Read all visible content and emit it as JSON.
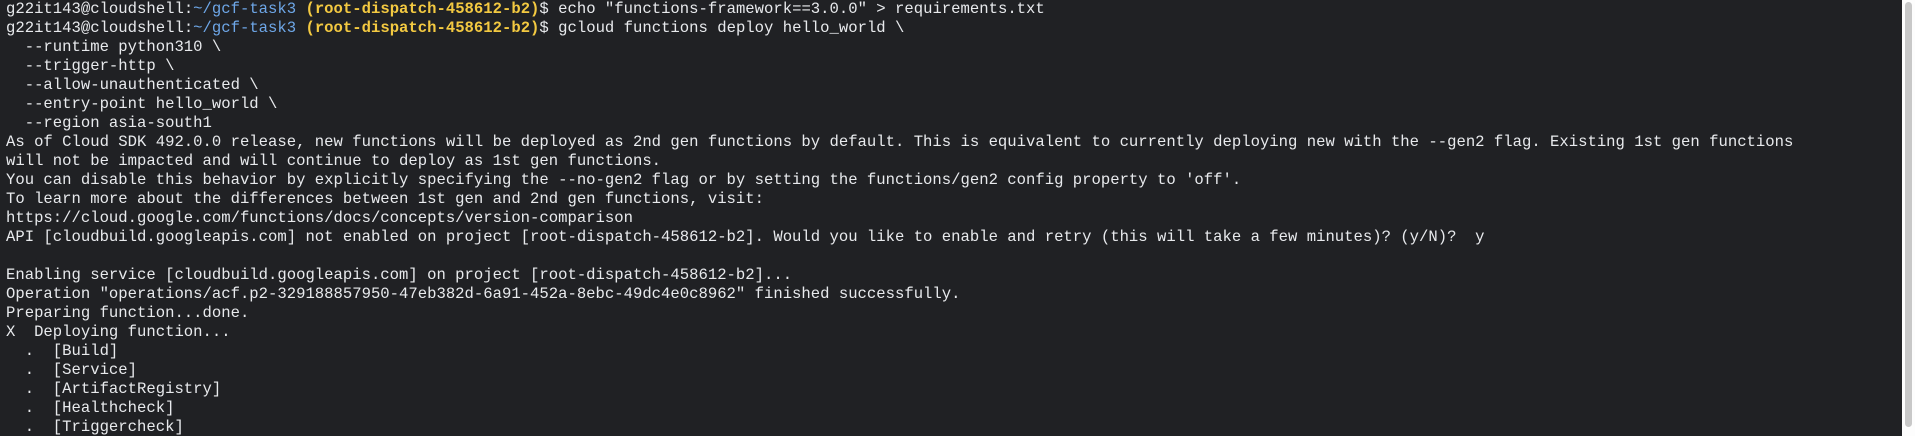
{
  "terminal": {
    "prompt": {
      "user_host": "g22it143@cloudshell",
      "separator": ":",
      "path": "~/gcf-task3",
      "project": "(root-dispatch-458612-b2)",
      "symbol": "$"
    },
    "commands": [
      "echo \"functions-framework==3.0.0\" > requirements.txt",
      "gcloud functions deploy hello_world \\"
    ],
    "output_lines": [
      "  --runtime python310 \\",
      "  --trigger-http \\",
      "  --allow-unauthenticated \\",
      "  --entry-point hello_world \\",
      "  --region asia-south1",
      "As of Cloud SDK 492.0.0 release, new functions will be deployed as 2nd gen functions by default. This is equivalent to currently deploying new with the --gen2 flag. Existing 1st gen functions",
      "will not be impacted and will continue to deploy as 1st gen functions.",
      "You can disable this behavior by explicitly specifying the --no-gen2 flag or by setting the functions/gen2 config property to 'off'.",
      "To learn more about the differences between 1st gen and 2nd gen functions, visit:",
      "https://cloud.google.com/functions/docs/concepts/version-comparison",
      "API [cloudbuild.googleapis.com] not enabled on project [root-dispatch-458612-b2]. Would you like to enable and retry (this will take a few minutes)? (y/N)?  y",
      "",
      "Enabling service [cloudbuild.googleapis.com] on project [root-dispatch-458612-b2]...",
      "Operation \"operations/acf.p2-329188857950-47eb382d-6a91-452a-8ebc-49dc4e0c8962\" finished successfully.",
      "Preparing function...done.",
      "X  Deploying function...",
      "  .  [Build]",
      "  .  [Service]",
      "  .  [ArtifactRegistry]",
      "  .  [Healthcheck]",
      "  .  [Triggercheck]"
    ]
  },
  "colors": {
    "background": "#202124",
    "text": "#e8eaed",
    "path": "#6ea7e8",
    "project": "#f3c941"
  }
}
